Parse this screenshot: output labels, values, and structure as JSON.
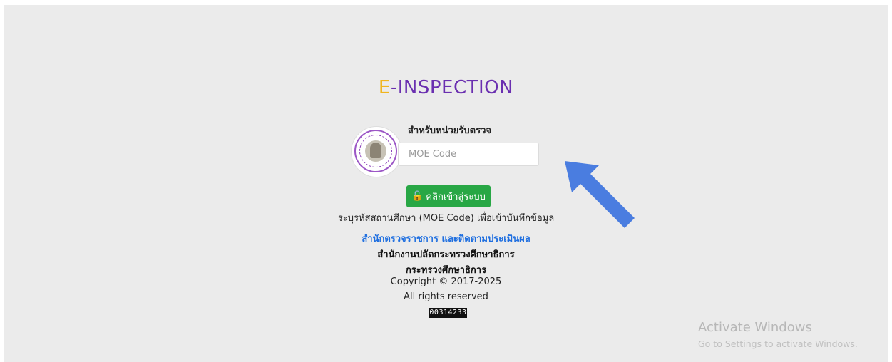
{
  "brand": {
    "e": "E",
    "rest": "-INSPECTION",
    "e_color": "#f0b51e",
    "rest_color": "#6a2fb0"
  },
  "login": {
    "label": "สำหรับหน่วยรับตรวจ",
    "input_value": "",
    "input_placeholder": "MOE Code",
    "button_label": "คลิกเข้าสู่ระบบ",
    "button_icon": "unlock-icon",
    "button_color": "#28a745",
    "hint": "ระบุรหัสสถานศึกษา (MOE Code) เพื่อเข้าบันทึกข้อมูล"
  },
  "footer": {
    "office_link": "สำนักตรวจราชการ และติดตามประเมินผล",
    "org": "สำนักงานปลัดกระทรวงศึกษาธิการ",
    "ministry": "กระทรวงศึกษาธิการ",
    "copyright": "Copyright © 2017-2025",
    "rights": "All rights reserved",
    "counter": "00314233",
    "link_color": "#1f6fe0"
  },
  "overlay": {
    "arrow_color": "#4a7de0",
    "arrow_icon": "pointer-arrow-icon"
  },
  "watermark": {
    "title": "Activate Windows",
    "subtitle": "Go to Settings to activate Windows."
  }
}
